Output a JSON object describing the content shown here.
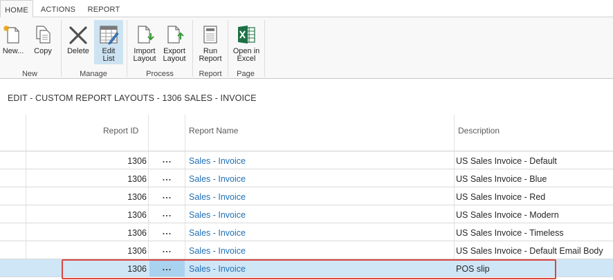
{
  "ribbon": {
    "tabs": [
      {
        "label": "HOME",
        "active": true
      },
      {
        "label": "ACTIONS",
        "active": false
      },
      {
        "label": "REPORT",
        "active": false
      }
    ],
    "buttons": {
      "new": {
        "label_1": "New...",
        "icon": "new-document-icon"
      },
      "copy": {
        "label_1": "Copy",
        "icon": "copy-icon"
      },
      "delete": {
        "label_1": "Delete",
        "icon": "delete-x-icon"
      },
      "edit_list": {
        "label_1": "Edit",
        "label_2": "List",
        "icon": "edit-list-icon",
        "selected": true
      },
      "import_layout": {
        "label_1": "Import",
        "label_2": "Layout",
        "icon": "import-layout-icon"
      },
      "export_layout": {
        "label_1": "Export",
        "label_2": "Layout",
        "icon": "export-layout-icon"
      },
      "run_report": {
        "label_1": "Run",
        "label_2": "Report",
        "icon": "run-report-icon"
      },
      "open_in_excel": {
        "label_1": "Open in",
        "label_2": "Excel",
        "icon": "excel-icon"
      }
    },
    "groups": {
      "new": "New",
      "manage": "Manage",
      "process": "Process",
      "report": "Report",
      "page": "Page"
    }
  },
  "page": {
    "title": "EDIT - CUSTOM REPORT LAYOUTS - 1306 SALES - INVOICE"
  },
  "table": {
    "columns": {
      "report_id": "Report ID",
      "report_name": "Report Name",
      "description": "Description"
    },
    "rows": [
      {
        "report_id": "1306",
        "actions": "...",
        "report_name": "Sales - Invoice",
        "description": "US Sales Invoice - Default",
        "selected": false
      },
      {
        "report_id": "1306",
        "actions": "...",
        "report_name": "Sales - Invoice",
        "description": "US Sales Invoice - Blue",
        "selected": false
      },
      {
        "report_id": "1306",
        "actions": "...",
        "report_name": "Sales - Invoice",
        "description": "US Sales Invoice - Red",
        "selected": false
      },
      {
        "report_id": "1306",
        "actions": "...",
        "report_name": "Sales - Invoice",
        "description": "US Sales Invoice - Modern",
        "selected": false
      },
      {
        "report_id": "1306",
        "actions": "...",
        "report_name": "Sales - Invoice",
        "description": "US Sales Invoice - Timeless",
        "selected": false
      },
      {
        "report_id": "1306",
        "actions": "...",
        "report_name": "Sales - Invoice",
        "description": "US Sales Invoice - Default Email Body",
        "selected": false
      },
      {
        "report_id": "1306",
        "actions": "...",
        "report_name": "Sales - Invoice",
        "description": "POS slip",
        "selected": true
      }
    ]
  },
  "colors": {
    "accent_link": "#1f6fb5",
    "selected_row": "#cfe6f7",
    "selected_button": "#cde3f2",
    "highlight_border": "#d9443f",
    "excel_green": "#1e7145"
  }
}
